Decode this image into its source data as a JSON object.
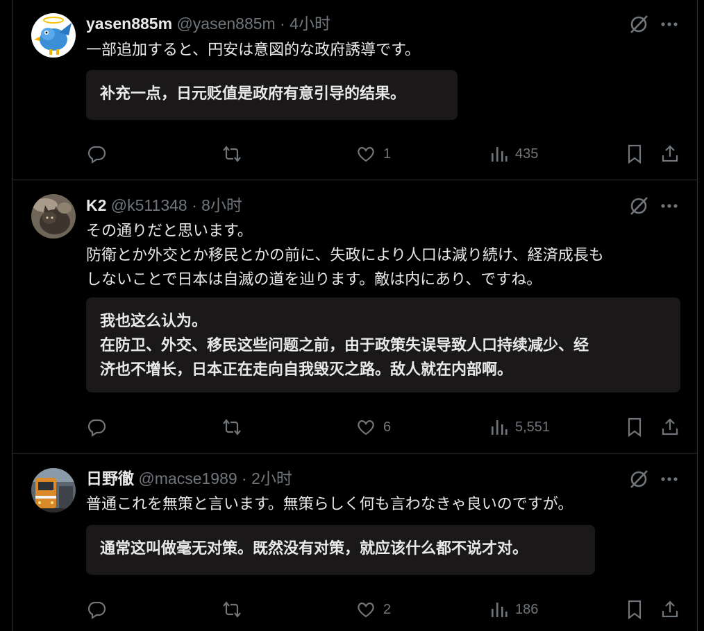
{
  "posts": [
    {
      "display_name": "yasen885m",
      "handle": "@yasen885m",
      "separator": "·",
      "time": "4小时",
      "text": "一部追加すると、円安は意図的な政府誘導です。",
      "translation": "补充一点，日元贬值是政府有意引导的结果。",
      "avatar_icon": "bird-avatar",
      "likes": "1",
      "views": "435",
      "replies": "",
      "reposts": ""
    },
    {
      "display_name": "K2",
      "handle": "@k511348",
      "separator": "·",
      "time": "8小时",
      "text": "その通りだと思います。\n防衛とか外交とか移民とかの前に、失政により人口は減り続け、経済成長も\nしないことで日本は自滅の道を辿ります。敵は内にあり、ですね。",
      "translation": "我也这么认为。\n在防卫、外交、移民这些问题之前，由于政策失误导致人口持续减少、经\n济也不增长，日本正在走向自我毁灭之路。敌人就在内部啊。",
      "avatar_icon": "cat-avatar",
      "likes": "6",
      "views": "5,551",
      "replies": "",
      "reposts": ""
    },
    {
      "display_name": "日野徹",
      "handle": "@macse1989",
      "separator": "·",
      "time": "2小时",
      "text": "普通これを無策と言います。無策らしく何も言わなきゃ良いのですが。",
      "translation": "通常这叫做毫无对策。既然没有对策，就应该什么都不说才对。",
      "avatar_icon": "train-avatar",
      "likes": "2",
      "views": "186",
      "replies": "",
      "reposts": ""
    }
  ],
  "colors": {
    "background": "#000000",
    "text": "#e7e9ea",
    "muted": "#71767b",
    "divider": "#2f3336",
    "translation_bg": "#1a1818"
  }
}
